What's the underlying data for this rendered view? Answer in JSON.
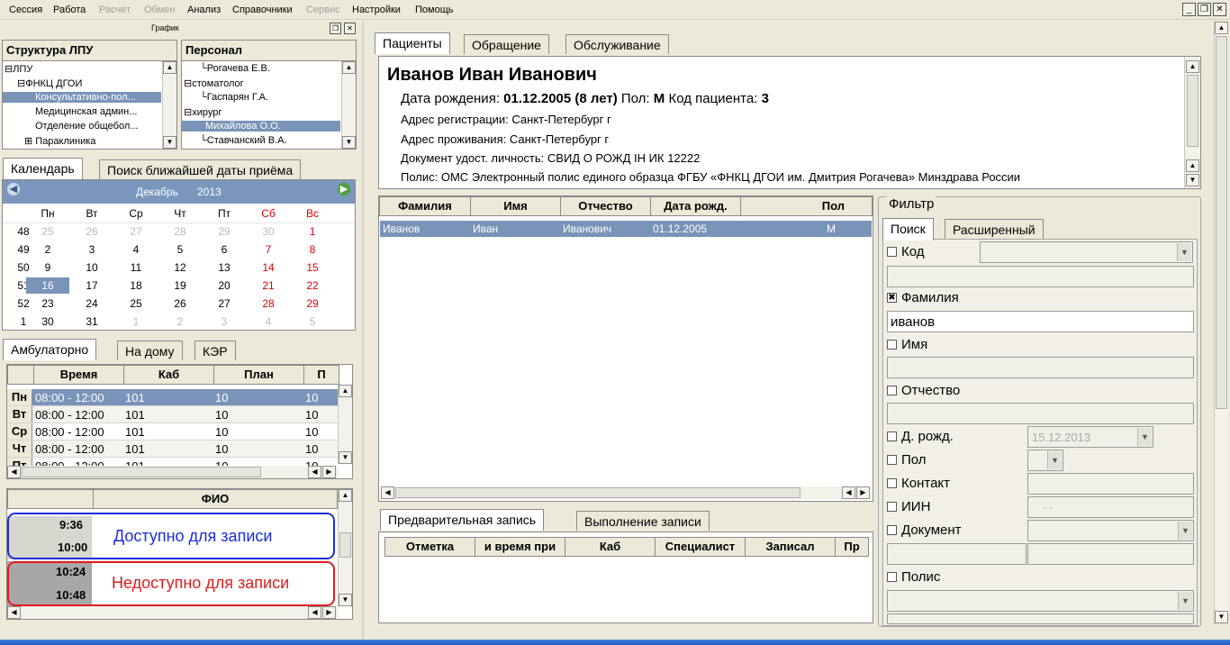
{
  "menu": {
    "items": [
      "Сессия",
      "Работа",
      "Расчет",
      "Обмен",
      "Анализ",
      "Справочники",
      "Сервис",
      "Настройки",
      "Помощь"
    ],
    "disabled": [
      "Расчет",
      "Обмен",
      "Сервис"
    ]
  },
  "schedule_label": "График",
  "lpu_panel": {
    "title": "Структура ЛПУ",
    "items": [
      "ЛПУ",
      "ФНКЦ ДГОИ",
      "Консультативно-пол...",
      "Медицинская админ...",
      "Отделение общебол...",
      "Параклиника"
    ]
  },
  "staff_panel": {
    "title": "Персонал",
    "items": [
      "Рогачева Е.В.",
      "стоматолог",
      "Гаспарян Г.А.",
      "хирург",
      "Михайлова О.О.",
      "Ставчанский В.А."
    ]
  },
  "left_tabs": [
    "Календарь",
    "Поиск ближайшей даты приёма"
  ],
  "calendar": {
    "month": "Декабрь",
    "year": "2013",
    "weekdays": [
      "Пн",
      "Вт",
      "Ср",
      "Чт",
      "Пт",
      "Сб",
      "Вс"
    ],
    "weeks": [
      {
        "n": "48",
        "days": [
          "25",
          "26",
          "27",
          "28",
          "29",
          "30",
          "1"
        ]
      },
      {
        "n": "49",
        "days": [
          "2",
          "3",
          "4",
          "5",
          "6",
          "7",
          "8"
        ]
      },
      {
        "n": "50",
        "days": [
          "9",
          "10",
          "11",
          "12",
          "13",
          "14",
          "15"
        ]
      },
      {
        "n": "51",
        "days": [
          "16",
          "17",
          "18",
          "19",
          "20",
          "21",
          "22"
        ]
      },
      {
        "n": "52",
        "days": [
          "23",
          "24",
          "25",
          "26",
          "27",
          "28",
          "29"
        ]
      },
      {
        "n": "1",
        "days": [
          "30",
          "31",
          "1",
          "2",
          "3",
          "4",
          "5"
        ]
      }
    ],
    "selected": "16"
  },
  "visit_tabs": [
    "Амбулаторно",
    "На дому",
    "КЭР"
  ],
  "plan_table": {
    "columns": [
      "Время",
      "Каб",
      "План",
      "П"
    ],
    "rows": [
      {
        "day": "Пн",
        "time": "08:00 - 12:00",
        "cab": "101",
        "plan": "10",
        "p": "10"
      },
      {
        "day": "Вт",
        "time": "08:00 - 12:00",
        "cab": "101",
        "plan": "10",
        "p": "10"
      },
      {
        "day": "Ср",
        "time": "08:00 - 12:00",
        "cab": "101",
        "plan": "10",
        "p": "10"
      },
      {
        "day": "Чт",
        "time": "08:00 - 12:00",
        "cab": "101",
        "plan": "10",
        "p": "10"
      },
      {
        "day": "Пт",
        "time": "08:00 - 12:00",
        "cab": "101",
        "plan": "10",
        "p": "10"
      }
    ]
  },
  "slots": {
    "column": "ФИО",
    "times": [
      "9:36",
      "10:00",
      "10:24",
      "10:48"
    ],
    "available_label": "Доступно для записи",
    "unavailable_label": "Недоступно для записи"
  },
  "main_tabs": [
    "Пациенты",
    "Обращение",
    "Обслуживание"
  ],
  "patient": {
    "name": "Иванов Иван Иванович",
    "birth_label": "Дата рождения:",
    "birth_value": "01.12.2005 (8 лет)",
    "sex_label": "Пол:",
    "sex_value": "М",
    "code_label": "Код пациента:",
    "code_value": "3",
    "reg_address": "Адрес регистрации: Санкт-Петербург г",
    "live_address": "Адрес проживания: Санкт-Петербург г",
    "document": "Документ удост. личность: СВИД О РОЖД IН ИК 12222",
    "policy": "Полис: ОМС Электронный полис единого образца ФГБУ «ФНКЦ ДГОИ им. Дмитрия Рогачева» Минздрава России"
  },
  "patients_table": {
    "columns": [
      "Фамилия",
      "Имя",
      "Отчество",
      "Дата рожд.",
      "Пол"
    ],
    "rows": [
      {
        "last": "Иванов",
        "first": "Иван",
        "middle": "Иванович",
        "birth": "01.12.2005",
        "sex": "М"
      }
    ]
  },
  "bottom_tabs": [
    "Предварительная запись",
    "Выполнение записи"
  ],
  "records_table": {
    "columns": [
      "Отметка",
      "и время при",
      "Каб",
      "Специалист",
      "Записал",
      "Пр"
    ]
  },
  "filter": {
    "title": "Фильтр",
    "tabs": [
      "Поиск",
      "Расширенный"
    ],
    "fields": [
      {
        "label": "Код",
        "checked": false
      },
      {
        "label": "Фамилия",
        "checked": true,
        "value": "иванов"
      },
      {
        "label": "Имя",
        "checked": false
      },
      {
        "label": "Отчество",
        "checked": false
      },
      {
        "label": "Д. рожд.",
        "checked": false,
        "value": "15.12.2013"
      },
      {
        "label": "Пол",
        "checked": false
      },
      {
        "label": "Контакт",
        "checked": false
      },
      {
        "label": "ИИН",
        "checked": false,
        "value": "-   -"
      },
      {
        "label": "Документ",
        "checked": false
      },
      {
        "label": "Полис",
        "checked": false
      }
    ]
  },
  "colors": {
    "selection": "#7994b8",
    "available_border": "#1c2ee0",
    "unavailable_border": "#e01c1c",
    "weekend": "#dd0000"
  }
}
